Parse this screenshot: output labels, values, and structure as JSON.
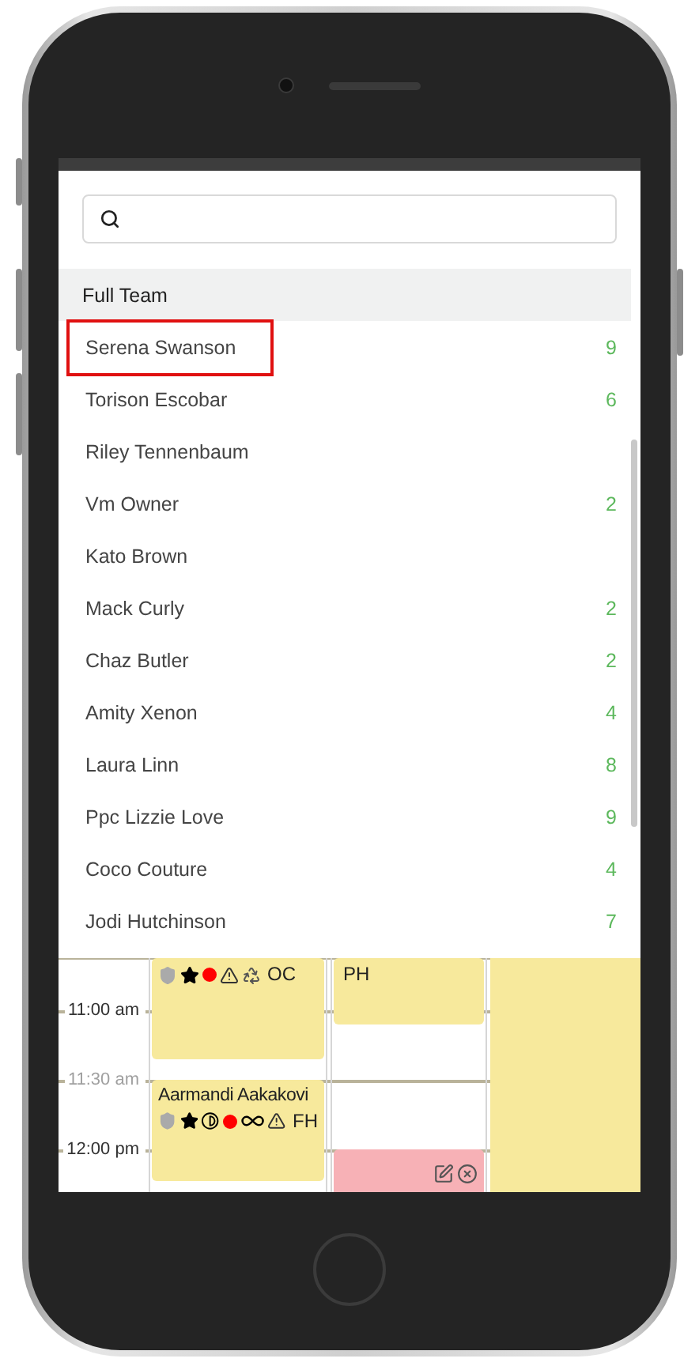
{
  "team_list": {
    "header": "Full Team",
    "items": [
      {
        "name": "Serena Swanson",
        "count": "9",
        "selected": true
      },
      {
        "name": "Torison Escobar",
        "count": "6",
        "selected": false
      },
      {
        "name": "Riley Tennenbaum",
        "selected": false
      },
      {
        "name": "Vm Owner",
        "count": "2",
        "selected": false
      },
      {
        "name": "Kato Brown",
        "selected": false
      },
      {
        "name": "Mack Curly",
        "count": "2",
        "selected": false
      },
      {
        "name": "Chaz Butler",
        "count": "2",
        "selected": false
      },
      {
        "name": "Amity Xenon",
        "count": "4",
        "selected": false
      },
      {
        "name": "Laura Linn",
        "count": "8",
        "selected": false
      },
      {
        "name": "Ppc Lizzie Love",
        "count": "9",
        "selected": false
      },
      {
        "name": "Coco Couture",
        "count": "4",
        "selected": false
      },
      {
        "name": "Jodi Hutchinson",
        "count": "7",
        "selected": false
      }
    ]
  },
  "calendar": {
    "times": [
      {
        "label": "11:00 am",
        "muted": false
      },
      {
        "label": "11:30 am",
        "muted": true
      },
      {
        "label": "12:00 pm",
        "muted": false
      }
    ],
    "columns": [
      {
        "events": [
          {
            "kind": "appointment",
            "icons": [
              {
                "kind": "shield"
              },
              {
                "kind": "star"
              },
              {
                "kind": "dot"
              },
              {
                "kind": "warning"
              },
              {
                "kind": "recycle"
              }
            ],
            "code": "OC"
          },
          {
            "kind": "appointment",
            "title": "Aarmandi Aakakovi",
            "icons": [
              {
                "kind": "shield"
              },
              {
                "kind": "star"
              },
              {
                "kind": "half"
              },
              {
                "kind": "dot"
              },
              {
                "kind": "infinity"
              },
              {
                "kind": "warning"
              }
            ],
            "code": "FH"
          }
        ]
      },
      {
        "events": [
          {
            "kind": "appointment",
            "code": "PH"
          },
          {
            "kind": "blocked"
          }
        ]
      },
      {
        "events": [
          {
            "kind": "open"
          }
        ]
      }
    ]
  }
}
